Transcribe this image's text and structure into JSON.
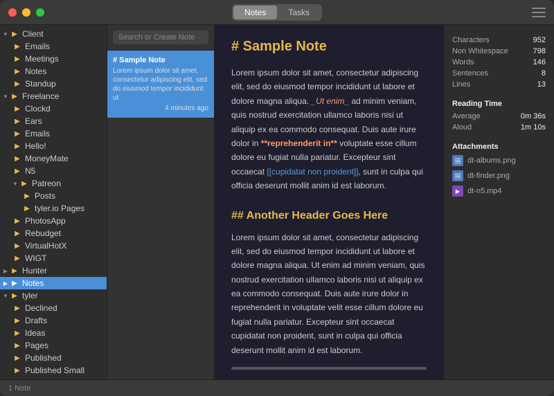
{
  "titlebar": {
    "tabs": [
      "Notes",
      "Tasks"
    ],
    "active_tab": "Notes"
  },
  "sidebar": {
    "tree": [
      {
        "id": "client",
        "label": "Client",
        "level": 0,
        "type": "folder-group",
        "expanded": true
      },
      {
        "id": "emails",
        "label": "Emails",
        "level": 1,
        "type": "folder"
      },
      {
        "id": "meetings",
        "label": "Meetings",
        "level": 1,
        "type": "folder"
      },
      {
        "id": "notes-client",
        "label": "Notes",
        "level": 1,
        "type": "folder"
      },
      {
        "id": "standup",
        "label": "Standup",
        "level": 1,
        "type": "folder"
      },
      {
        "id": "freelance",
        "label": "Freelance",
        "level": 0,
        "type": "folder-group",
        "expanded": true
      },
      {
        "id": "clockd",
        "label": "Clockd",
        "level": 1,
        "type": "folder"
      },
      {
        "id": "ears",
        "label": "Ears",
        "level": 1,
        "type": "folder"
      },
      {
        "id": "emails2",
        "label": "Emails",
        "level": 1,
        "type": "folder"
      },
      {
        "id": "hello",
        "label": "Hello!",
        "level": 1,
        "type": "folder"
      },
      {
        "id": "moneymate",
        "label": "MoneyMate",
        "level": 1,
        "type": "folder"
      },
      {
        "id": "n5",
        "label": "N5",
        "level": 1,
        "type": "folder"
      },
      {
        "id": "patreon",
        "label": "Patreon",
        "level": 1,
        "type": "folder-group",
        "expanded": true
      },
      {
        "id": "posts",
        "label": "Posts",
        "level": 2,
        "type": "folder"
      },
      {
        "id": "tylerpages",
        "label": "tyler.io Pages",
        "level": 2,
        "type": "folder"
      },
      {
        "id": "photosapp",
        "label": "PhotosApp",
        "level": 1,
        "type": "folder"
      },
      {
        "id": "rebudget",
        "label": "Rebudget",
        "level": 1,
        "type": "folder"
      },
      {
        "id": "virtualhot",
        "label": "VirtualHotX",
        "level": 1,
        "type": "folder"
      },
      {
        "id": "wigt",
        "label": "WIGT",
        "level": 1,
        "type": "folder"
      },
      {
        "id": "hunter",
        "label": "Hunter",
        "level": 0,
        "type": "folder"
      },
      {
        "id": "notes",
        "label": "Notes",
        "level": 0,
        "type": "folder",
        "selected": true
      },
      {
        "id": "tyler",
        "label": "tyler",
        "level": 0,
        "type": "folder-group",
        "expanded": true
      },
      {
        "id": "declined",
        "label": "Declined",
        "level": 1,
        "type": "folder"
      },
      {
        "id": "drafts",
        "label": "Drafts",
        "level": 1,
        "type": "folder"
      },
      {
        "id": "ideas",
        "label": "Ideas",
        "level": 1,
        "type": "folder"
      },
      {
        "id": "pages",
        "label": "Pages",
        "level": 1,
        "type": "folder"
      },
      {
        "id": "published",
        "label": "Published",
        "level": 1,
        "type": "folder"
      },
      {
        "id": "published-small",
        "label": "Published Small",
        "level": 1,
        "type": "folder"
      }
    ]
  },
  "note_list": {
    "search_placeholder": "Search or Create Note",
    "notes": [
      {
        "id": "sample",
        "title": "# Sample Note",
        "preview": "Lorem ipsum dolor sit amet, consectetur adipiscing elit, sed do eiusmod tempor incididunt ut",
        "time": "4 minutes ago",
        "selected": true
      }
    ]
  },
  "editor": {
    "h1": "# Sample Note",
    "p1": "Lorem ipsum dolor sit amet, consectetur adipiscing elit, sed do eiusmod tempor incididunt ut labore et dolore magna aliqua. ",
    "p1_italic": "_Ut enim_",
    "p1_mid": " ad minim veniam, quis nostrud exercitation ullamco laboris nisi ut aliquip ex ea commodo consequat. Duis aute irure dolor in ",
    "p1_bold": "**reprehenderit in**",
    "p1_end": " voluptate esse cillum dolore eu fugiat nulla pariatur. Excepteur sint occaecat ",
    "p1_link": "[[cupidatat non proident]]",
    "p1_tail": ", sunt in culpa qui officia deserunt mollit anim id est laborum.",
    "h2": "## Another Header Goes Here",
    "p2": "Lorem ipsum dolor sit amet, consectetur adipiscing elit, sed do eiusmod tempor incididunt ut labore et dolore magna aliqua. Ut enim ad minim veniam, quis nostrud exercitation ullamco laboris nisi ut aliquip ex ea commodo consequat. Duis aute irure dolor in reprehenderit in voluptate velit esse cillum dolore eu fugiat nulla pariatur. Excepteur sint occaecat cupidatat non proident, sunt in culpa qui officia deserunt mollit anim id est laborum."
  },
  "stats": {
    "section_label": "",
    "rows": [
      {
        "label": "Characters",
        "value": "952"
      },
      {
        "label": "Non Whitespace",
        "value": "798"
      },
      {
        "label": "Words",
        "value": "146"
      },
      {
        "label": "Sentences",
        "value": "8"
      },
      {
        "label": "Lines",
        "value": "13"
      }
    ],
    "reading_time_label": "Reading Time",
    "reading_rows": [
      {
        "label": "Average",
        "value": "0m 36s"
      },
      {
        "label": "Aloud",
        "value": "1m 10s"
      }
    ],
    "attachments_label": "Attachments",
    "attachments": [
      {
        "name": "dt-albums.png",
        "type": "img"
      },
      {
        "name": "dt-finder.png",
        "type": "img"
      },
      {
        "name": "dt-n5.mp4",
        "type": "vid"
      }
    ]
  },
  "statusbar": {
    "text": "1 Note"
  }
}
